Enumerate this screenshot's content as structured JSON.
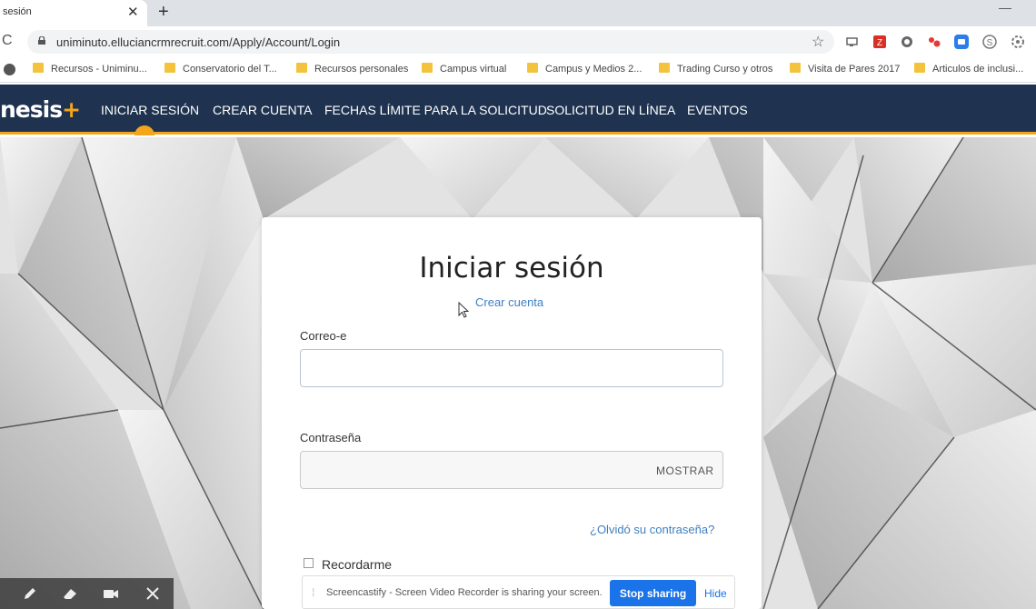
{
  "browser": {
    "tab_title": "sesión",
    "tab_close": "✕",
    "new_tab": "+",
    "minimize": "—",
    "reload": "C",
    "url": "uniminuto.elluciancrmrecruit.com/Apply/Account/Login",
    "star": "☆",
    "bookmarks": [
      "Recursos - Uniminu...",
      "Conservatorio del T...",
      "Recursos personales",
      "Campus virtual",
      "Campus y Medios 2...",
      "Trading Curso y otros",
      "Visita de Pares 2017",
      "Articulos de inclusi..."
    ]
  },
  "site": {
    "logo_text": "nesis",
    "logo_plus": "+",
    "nav": [
      "INICIAR SESIÓN",
      "CREAR CUENTA",
      "FECHAS LÍMITE PARA LA SOLICITUD",
      "SOLICITUD EN LÍNEA",
      "EVENTOS"
    ],
    "accent": "#f3a51b",
    "nav_bg": "#1f3350"
  },
  "login": {
    "title": "Iniciar sesión",
    "create_account": "Crear cuenta",
    "email_label": "Correo-e",
    "email_value": "",
    "password_label": "Contraseña",
    "password_value": "",
    "show_label": "MOSTRAR",
    "forgot": "¿Olvidó su contraseña?",
    "remember": "Recordarme"
  },
  "screencastify": {
    "grip": "⁞",
    "message": "Screencastify - Screen Video Recorder is sharing your screen.",
    "stop": "Stop sharing",
    "hide": "Hide"
  },
  "recorder_tools": [
    "pencil-icon",
    "eraser-icon",
    "camera-icon",
    "close-icon"
  ]
}
